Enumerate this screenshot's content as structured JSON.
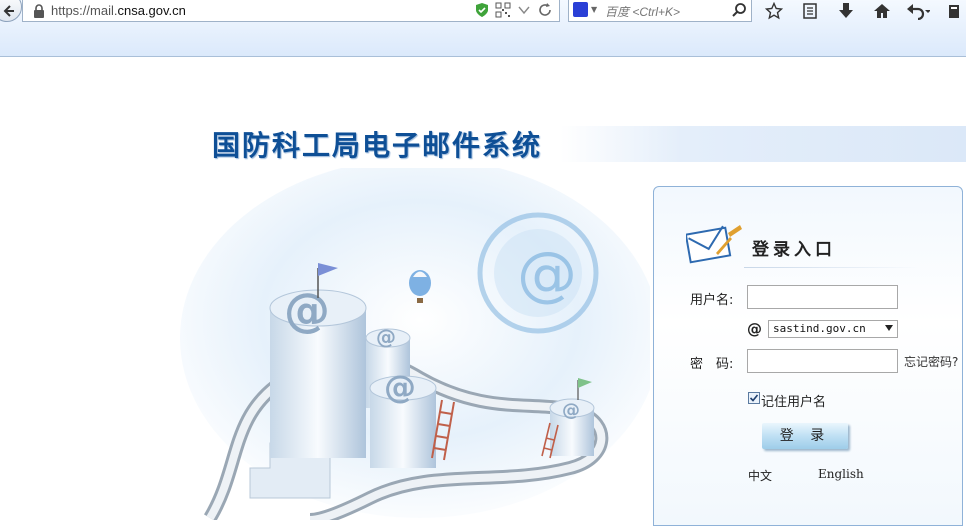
{
  "browser": {
    "url_prefix": "https://mail.",
    "url_domain": "cnsa.gov.cn",
    "search_placeholder": "百度 <Ctrl+K>"
  },
  "page": {
    "title": "国防科工局电子邮件系统"
  },
  "login": {
    "heading": "登录入口",
    "username_label": "用户名:",
    "username_value": "",
    "at_symbol": "@",
    "domain_selected": "sastind.gov.cn",
    "password_label": "密　码:",
    "password_value": "",
    "forgot_password": "忘记密码?",
    "remember_label": "记住用户名",
    "remember_checked": true,
    "login_button": "登 录",
    "lang_chinese": "中文",
    "lang_english": "English"
  },
  "colors": {
    "title": "#0e4f96",
    "accent": "#2a6fb8"
  },
  "icons": [
    "back-arrow-icon",
    "lock-icon",
    "shield-icon",
    "qr-icon",
    "dropdown-icon",
    "reload-icon",
    "baidu-icon",
    "magnifier-icon",
    "star-icon",
    "reading-list-icon",
    "download-icon",
    "home-icon",
    "undo-icon",
    "envelope-icon",
    "at-icon",
    "checkmark-icon"
  ]
}
